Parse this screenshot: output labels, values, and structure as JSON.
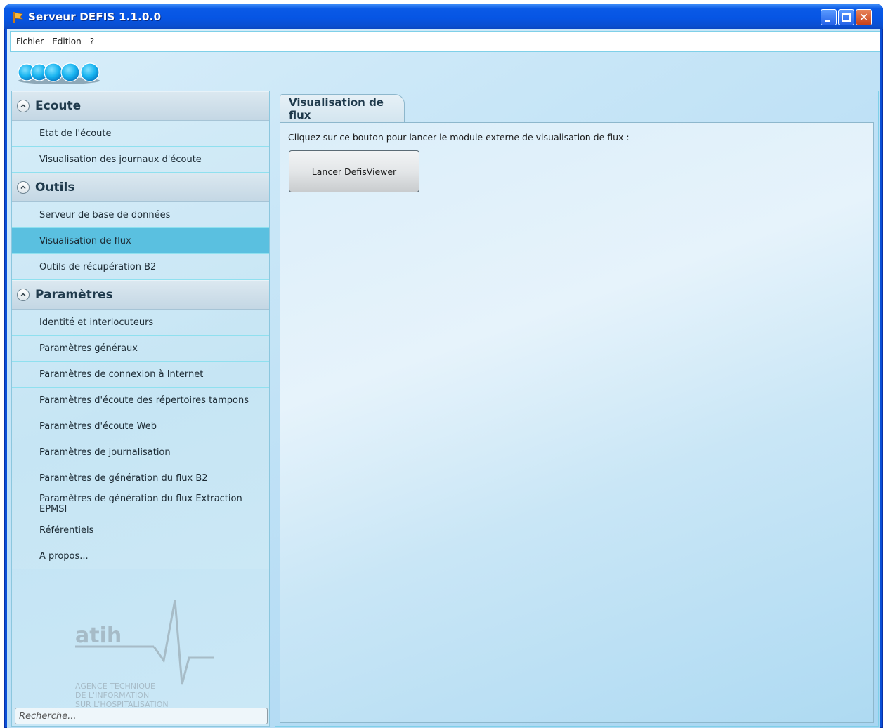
{
  "window": {
    "title": "Serveur DEFIS 1.1.0.0",
    "controls": [
      "minimize-icon",
      "maximize-icon",
      "close-icon"
    ],
    "close_glyph": "✕"
  },
  "menu": {
    "items": [
      "Fichier",
      "Edition",
      "?"
    ]
  },
  "sidebar": {
    "sections": [
      {
        "title": "Ecoute",
        "items": [
          "Etat de l'écoute",
          "Visualisation des journaux d'écoute"
        ]
      },
      {
        "title": "Outils",
        "items": [
          "Serveur de base de données",
          "Visualisation de flux",
          "Outils de récupération B2"
        ]
      },
      {
        "title": "Paramètres",
        "items": [
          "Identité et interlocuteurs",
          "Paramètres généraux",
          "Paramètres de connexion à Internet",
          "Paramètres d'écoute des répertoires tampons",
          "Paramètres d'écoute Web",
          "Paramètres de journalisation",
          "Paramètres de génération du flux B2",
          "Paramètres de génération du flux Extraction EPMSI",
          "Référentiels",
          "A propos..."
        ]
      }
    ],
    "selected": "Visualisation de flux",
    "logo": {
      "name": "atih",
      "lines": [
        "AGENCE TECHNIQUE",
        "DE L'INFORMATION",
        "SUR L'HOSPITALISATION"
      ]
    },
    "search": {
      "placeholder": "Recherche..."
    }
  },
  "main": {
    "tab_label": "Visualisation de flux",
    "instruction": "Cliquez sur ce bouton pour lancer le module externe de visualisation de flux :",
    "button_label": "Lancer DefisViewer"
  },
  "colors": {
    "titlebar": "#0a5ae6",
    "selected_item": "#5ac0e0",
    "background": "#c8e6f7",
    "section_header": "#c4d7e4"
  }
}
